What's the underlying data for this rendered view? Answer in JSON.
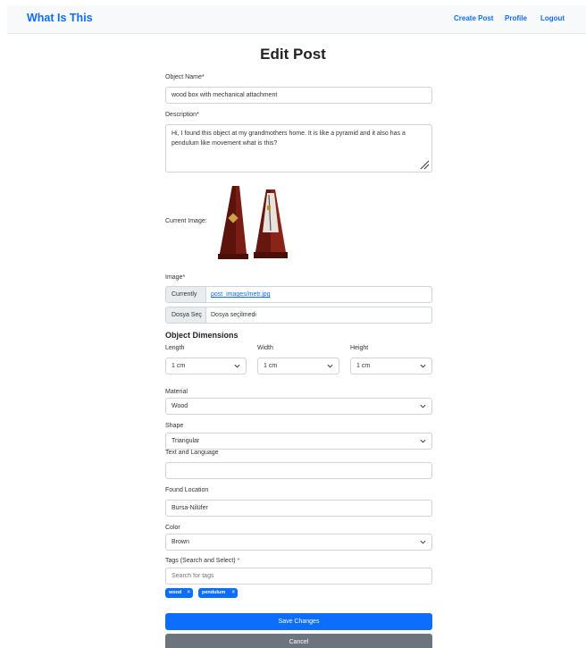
{
  "navbar": {
    "brand": "What Is This",
    "links": [
      "Create Post",
      "Profile",
      "Logout"
    ]
  },
  "page": {
    "title": "Edit Post"
  },
  "form": {
    "object_name": {
      "label": "Object Name*",
      "value": "wood box with mechanical attachment"
    },
    "description": {
      "label": "Description*",
      "value": "Hi, I found this object at my grandmothers home. It is like a pyramid and it also has a pendulum like movement what is this?"
    },
    "current_image": {
      "label": "Current Image:"
    },
    "image": {
      "label": "Image*",
      "currently_label": "Currently",
      "currently_value": "post_images/metr.jpg",
      "file_button": "Dosya Seç",
      "file_status": "Dosya seçilmedi"
    },
    "dimensions": {
      "title": "Object Dimensions",
      "length": {
        "label": "Length",
        "value": "1 cm"
      },
      "width": {
        "label": "Width",
        "value": "1 cm"
      },
      "height": {
        "label": "Height",
        "value": "1 cm"
      }
    },
    "material": {
      "label": "Material",
      "value": "Wood"
    },
    "shape": {
      "label": "Shape",
      "value": "Triangular"
    },
    "text_language": {
      "label": "Text and Language",
      "value": ""
    },
    "found_location": {
      "label": "Found Location",
      "value": "Bursa-Nilüfer"
    },
    "color": {
      "label": "Color",
      "value": "Brown"
    },
    "tags": {
      "label": "Tags (Search and Select)",
      "required_mark": "*",
      "placeholder": "Search for tags",
      "selected": [
        "wood",
        "pendulum"
      ]
    }
  },
  "buttons": {
    "save": "Save Changes",
    "cancel": "Cancel"
  },
  "colors": {
    "primary": "#0d6efd",
    "secondary": "#6c757d",
    "danger": "#dc3545"
  }
}
